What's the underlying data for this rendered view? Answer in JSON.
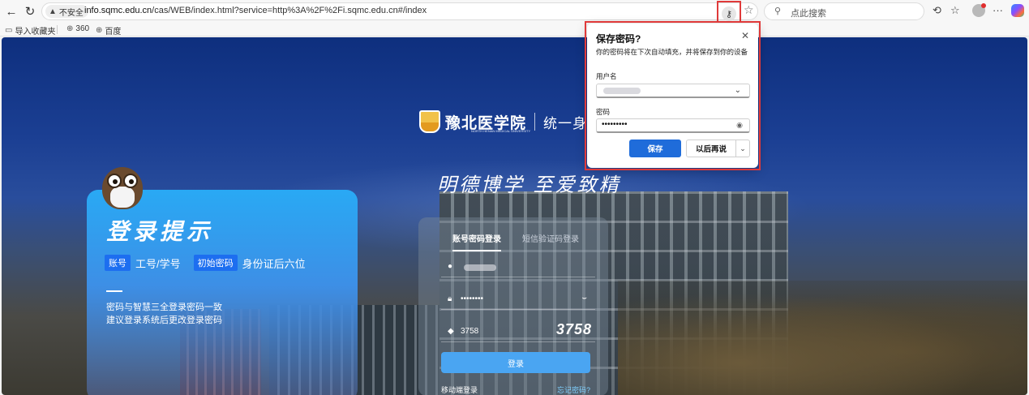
{
  "browser": {
    "insecure_label": "不安全",
    "url_host": "info.sqmc.edu.cn",
    "url_path": "/cas/WEB/index.html?service=http%3A%2F%2Fi.sqmc.edu.cn#/index",
    "search_placeholder": "点此搜索",
    "accent_color": "#e03a3a"
  },
  "bookmarks": [
    {
      "label": "导入收藏夹",
      "icon": "import-icon"
    },
    {
      "label": "360",
      "icon": "globe-icon"
    },
    {
      "label": "百度",
      "icon": "globe-icon"
    }
  ],
  "page": {
    "logo_cn": "豫北医学院",
    "logo_en": "NORTH HENAN MEDICAL UNIVERSITY",
    "system_title": "统一身份认",
    "motto": "明德博学 至爱致精",
    "promo": {
      "title": "登录提示",
      "tag_account": "账号",
      "account_value": "工号/学号",
      "tag_initial": "初始密码",
      "initial_value": "身份证后六位",
      "note1": "密码与智慧三全登录密码一致",
      "note2": "建议登录系统后更改登录密码"
    },
    "login": {
      "tab_password": "账号密码登录",
      "tab_sms": "短信验证码登录",
      "password_mask": "••••••••",
      "captcha_input": "3758",
      "captcha_image": "3758",
      "submit": "登录",
      "remember": "移动端登录",
      "forgot": "忘记密码?"
    }
  },
  "save_password_popup": {
    "title": "保存密码?",
    "description": "你的密码将在下次自动填充，并将保存到你的设备",
    "username_label": "用户名",
    "password_label": "密码",
    "password_mask": "•••••••••",
    "save_button": "保存",
    "later_button": "以后再说",
    "primary_color": "#1f6cda"
  }
}
